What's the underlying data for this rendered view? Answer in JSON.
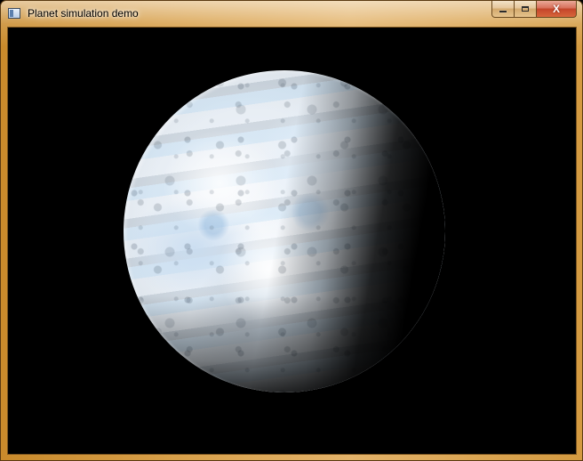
{
  "window": {
    "title": "Planet simulation demo",
    "icon": "app-window-icon",
    "frame_color": "#d8a04a"
  },
  "caption_buttons": {
    "minimize_icon": "minimize-icon",
    "maximize_icon": "maximize-icon",
    "close_icon": "close-icon",
    "close_glyph": "X",
    "close_color": "#c4452a"
  },
  "viewport": {
    "background": "#000000",
    "scene": "planet-render"
  }
}
